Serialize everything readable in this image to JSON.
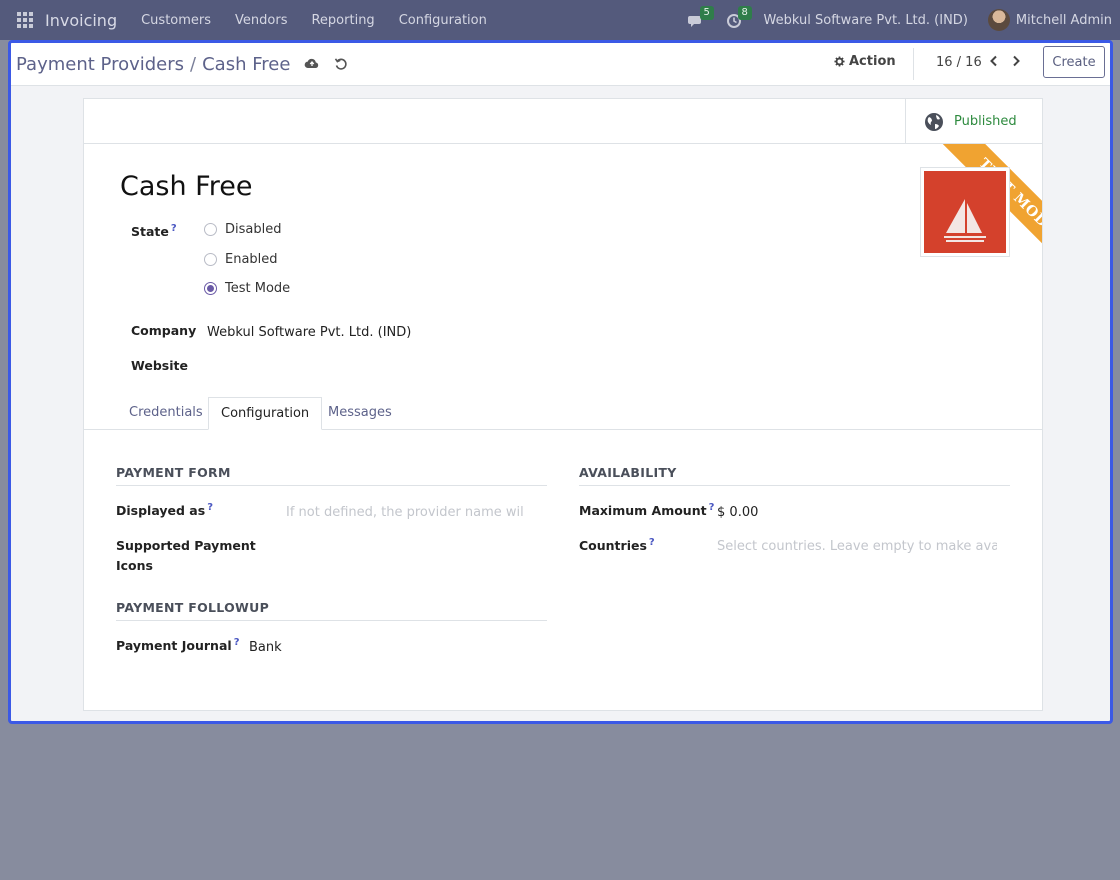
{
  "navbar": {
    "app_name": "Invoicing",
    "menu": [
      "Customers",
      "Vendors",
      "Reporting",
      "Configuration"
    ],
    "messages_count": "5",
    "activities_count": "8",
    "company": "Webkul Software Pvt. Ltd. (IND)",
    "user": "Mitchell Admin"
  },
  "breadcrumb": {
    "parent": "Payment Providers",
    "separator": "/",
    "current": "Cash Free"
  },
  "control": {
    "action_label": "Action",
    "pager": "16 / 16",
    "create_label": "Create"
  },
  "button_box": {
    "published_label": "Published"
  },
  "ribbon": {
    "text": "TEST MODE",
    "color": "#f0a331"
  },
  "form": {
    "title": "Cash Free",
    "state_label": "State",
    "state_options": [
      "Disabled",
      "Enabled",
      "Test Mode"
    ],
    "state_selected": "Test Mode",
    "company_label": "Company",
    "company_value": "Webkul Software Pvt. Ltd. (IND)",
    "website_label": "Website",
    "website_value": ""
  },
  "tabs": [
    {
      "label": "Credentials",
      "active": false
    },
    {
      "label": "Configuration",
      "active": true
    },
    {
      "label": "Messages",
      "active": false
    }
  ],
  "configuration": {
    "payment_form_title": "PAYMENT FORM",
    "displayed_as_label": "Displayed as",
    "displayed_as_placeholder": "If not defined, the provider name will be",
    "supported_icons_label_1": "Supported Payment",
    "supported_icons_label_2": "Icons",
    "payment_followup_title": "PAYMENT FOLLOWUP",
    "payment_journal_label": "Payment Journal",
    "payment_journal_value": "Bank",
    "availability_title": "AVAILABILITY",
    "max_amount_label": "Maximum Amount",
    "currency_symbol": "$",
    "max_amount_value": "0.00",
    "countries_label": "Countries",
    "countries_placeholder": "Select countries. Leave empty to make available"
  },
  "help_mark": "?",
  "colors": {
    "navbar": "#545a7c",
    "focus_border": "#3b59e6",
    "published": "#2d8a3e",
    "radio_checked": "#6a5aa6"
  }
}
